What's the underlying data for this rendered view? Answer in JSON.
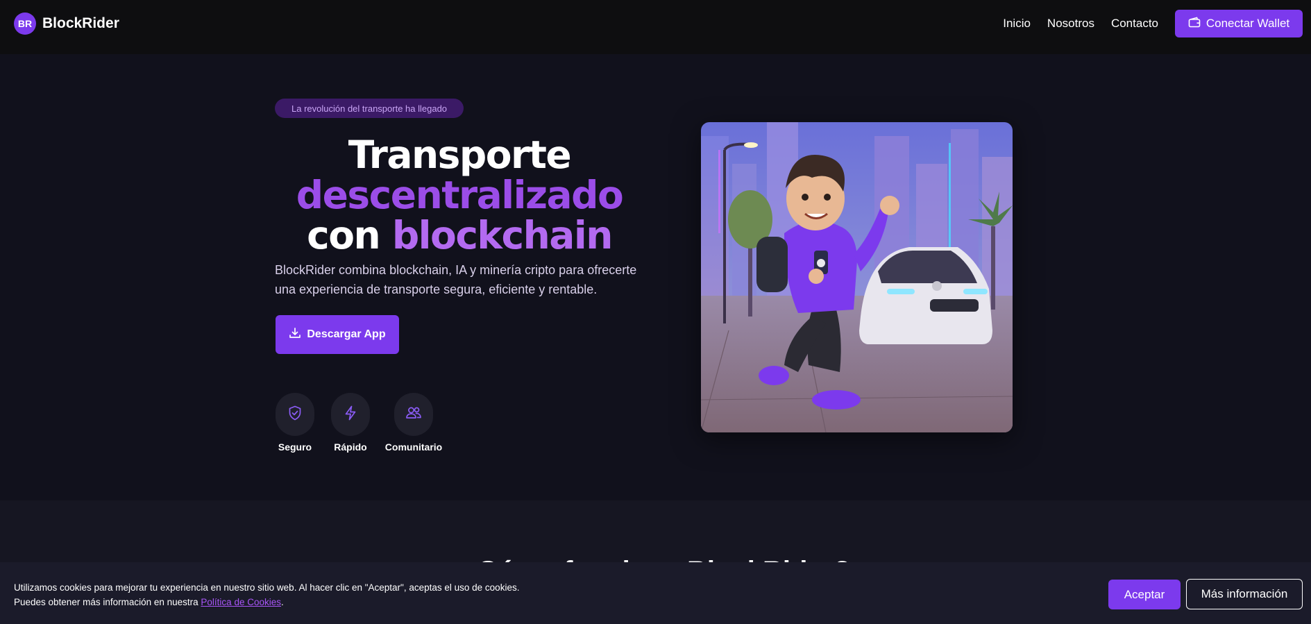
{
  "nav": {
    "logo_initials": "BR",
    "brand": "BlockRider",
    "links": [
      "Inicio",
      "Nosotros",
      "Contacto"
    ],
    "wallet_button": "Conectar Wallet",
    "wallet_icon": "wallet-icon"
  },
  "hero": {
    "tagline": "La revolución del transporte ha llegado",
    "headline": {
      "line1": "Transporte",
      "line2": "descentralizado",
      "line3a": "con",
      "line3b": "blockchain"
    },
    "description": "BlockRider combina blockchain, IA y minería cripto para ofrecerte una experiencia de transporte segura, eficiente y rentable.",
    "download_button": "Descargar App",
    "download_icon": "download-icon",
    "features": [
      {
        "label": "Seguro",
        "icon": "shield-check-icon"
      },
      {
        "label": "Rápido",
        "icon": "lightning-icon"
      },
      {
        "label": "Comunitario",
        "icon": "users-icon"
      }
    ]
  },
  "next_section": {
    "title_partial": "¿Cómo funciona BlockRider?"
  },
  "cookie_banner": {
    "text_line1": "Utilizamos cookies para mejorar tu experiencia en nuestro sitio web. Al hacer clic en \"Aceptar\", aceptas el uso de cookies.",
    "text_line2_prefix": "Puedes obtener más información en nuestra ",
    "link_text": "Política de Cookies",
    "text_line2_suffix": ".",
    "accept_button": "Aceptar",
    "more_button": "Más información"
  },
  "colors": {
    "accent": "#7c3aed",
    "accent_light": "#9b4de8",
    "background": "#11111c",
    "navbar": "#0e0e10"
  }
}
